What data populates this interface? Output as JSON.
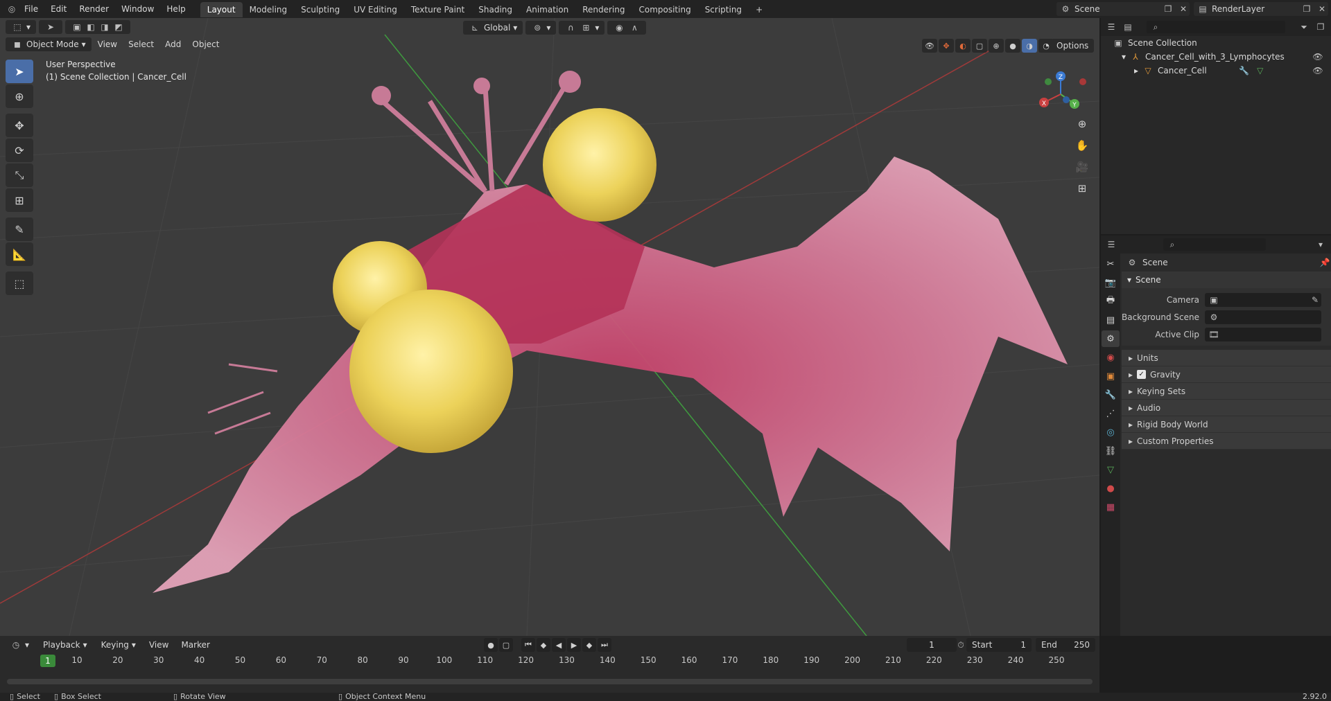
{
  "topbar": {
    "menus": [
      "File",
      "Edit",
      "Render",
      "Window",
      "Help"
    ],
    "workspaces": [
      "Layout",
      "Modeling",
      "Sculpting",
      "UV Editing",
      "Texture Paint",
      "Shading",
      "Animation",
      "Rendering",
      "Compositing",
      "Scripting"
    ],
    "active_workspace": "Layout",
    "add_tab": "+",
    "scene": "Scene",
    "render_layer": "RenderLayer"
  },
  "viewport": {
    "mode": "Object Mode",
    "menus": [
      "View",
      "Select",
      "Add",
      "Object"
    ],
    "orientation": "Global",
    "options": "Options",
    "info_line1": "User Perspective",
    "info_line2": "(1) Scene Collection | Cancer_Cell"
  },
  "gizmo": {
    "x": "X",
    "y": "Y",
    "z": "Z"
  },
  "outliner": {
    "root": "Scene Collection",
    "items": [
      {
        "label": "Cancer_Cell_with_3_Lymphocytes"
      },
      {
        "label": "Cancer_Cell"
      }
    ]
  },
  "properties": {
    "header": "Scene",
    "panel": "Scene",
    "fields": [
      {
        "label": "Camera"
      },
      {
        "label": "Background Scene"
      },
      {
        "label": "Active Clip"
      }
    ],
    "sections": [
      "Units",
      "Gravity",
      "Keying Sets",
      "Audio",
      "Rigid Body World",
      "Custom Properties"
    ]
  },
  "timeline": {
    "menus": [
      "Playback",
      "Keying",
      "View",
      "Marker"
    ],
    "current_frame": "1",
    "start_label": "Start",
    "start": "1",
    "end_label": "End",
    "end": "250",
    "ticks": [
      "10",
      "20",
      "30",
      "40",
      "50",
      "60",
      "70",
      "80",
      "90",
      "100",
      "110",
      "120",
      "130",
      "140",
      "150",
      "160",
      "170",
      "180",
      "190",
      "200",
      "210",
      "220",
      "230",
      "240",
      "250"
    ]
  },
  "status": {
    "select": "Select",
    "box_select": "Box Select",
    "rotate_view": "Rotate View",
    "context_menu": "Object Context Menu",
    "version": "2.92.0"
  },
  "colors": {
    "accent": "#4a6ea8",
    "x_axis": "#c94040",
    "y_axis": "#56b04a",
    "z_axis": "#3b7bd4",
    "cell": "#d06a8e",
    "lymphocyte": "#f2d860"
  }
}
